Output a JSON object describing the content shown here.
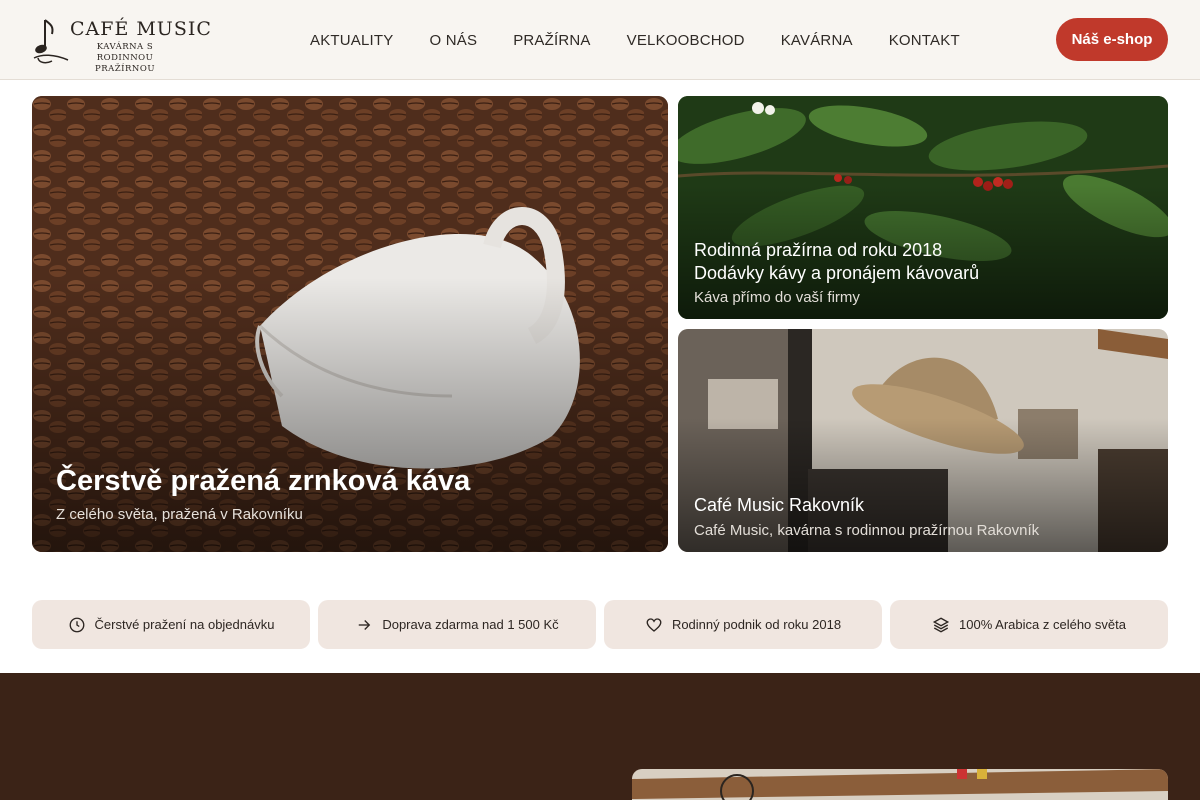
{
  "logo": {
    "title": "CAFÉ MUSIC",
    "subtitle": "KAVÁRNA S RODINNOU PRAŽÍRNOU"
  },
  "nav": {
    "items": [
      {
        "label": "AKTUALITY"
      },
      {
        "label": "O NÁS"
      },
      {
        "label": "PRAŽÍRNA"
      },
      {
        "label": "VELKOOBCHOD"
      },
      {
        "label": "KAVÁRNA"
      },
      {
        "label": "KONTAKT"
      }
    ],
    "eshop_label": "Náš e-shop"
  },
  "hero": {
    "main": {
      "title": "Čerstvě pražená zrnková káva",
      "subtitle": "Z celého světa, pražená v Rakovníku"
    },
    "top_right": {
      "title_line1": "Rodinná pražírna od roku 2018",
      "title_line2": "Dodávky kávy a pronájem kávovarů",
      "subtitle": "Káva přímo do vaší firmy"
    },
    "bottom_right": {
      "title": "Café Music Rakovník",
      "subtitle": "Café Music, kavárna s rodinnou pražírnou Rakovník"
    }
  },
  "benefits": [
    {
      "icon": "clock-icon",
      "label": "Čerstvé pražení na objednávku"
    },
    {
      "icon": "arrow-right-icon",
      "label": "Doprava zdarma nad 1 500 Kč"
    },
    {
      "icon": "heart-icon",
      "label": "Rodinný podnik od roku 2018"
    },
    {
      "icon": "layers-icon",
      "label": "100% Arabica z celého světa"
    }
  ],
  "colors": {
    "accent": "#c0392b",
    "header_bg": "#f8f5f1",
    "pill_bg": "#f0e6e0",
    "dark_section": "#3b2317"
  }
}
